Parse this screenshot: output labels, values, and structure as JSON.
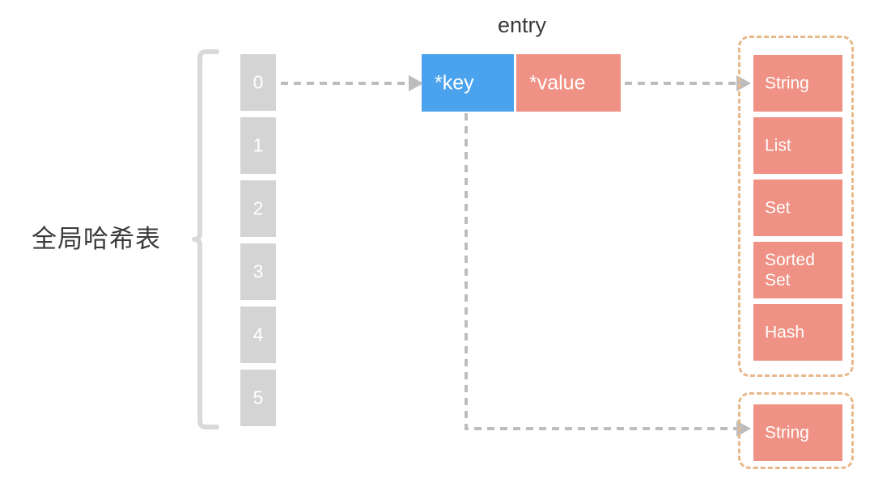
{
  "diagram": {
    "title_label": "全局哈希表",
    "entry_label": "entry",
    "colors": {
      "cell_gray": "#d4d4d4",
      "key_blue": "#4ba3ee",
      "value_salmon": "#ef9184",
      "dashed_orange": "#e8b88a",
      "arrow_gray": "#bdbdbd",
      "brace_gray": "#d9d9d9",
      "text_dark": "#3b3b3b"
    }
  },
  "hash_table": {
    "cells": [
      {
        "index": "0"
      },
      {
        "index": "1"
      },
      {
        "index": "2"
      },
      {
        "index": "3"
      },
      {
        "index": "4"
      },
      {
        "index": "5"
      }
    ]
  },
  "entry": {
    "key_label": "*key",
    "value_label": "*value"
  },
  "value_types_primary": [
    {
      "name": "String"
    },
    {
      "name": "List"
    },
    {
      "name": "Set"
    },
    {
      "name": "Sorted\nSet"
    },
    {
      "name": "Hash"
    }
  ],
  "value_types_secondary": [
    {
      "name": "String"
    }
  ]
}
